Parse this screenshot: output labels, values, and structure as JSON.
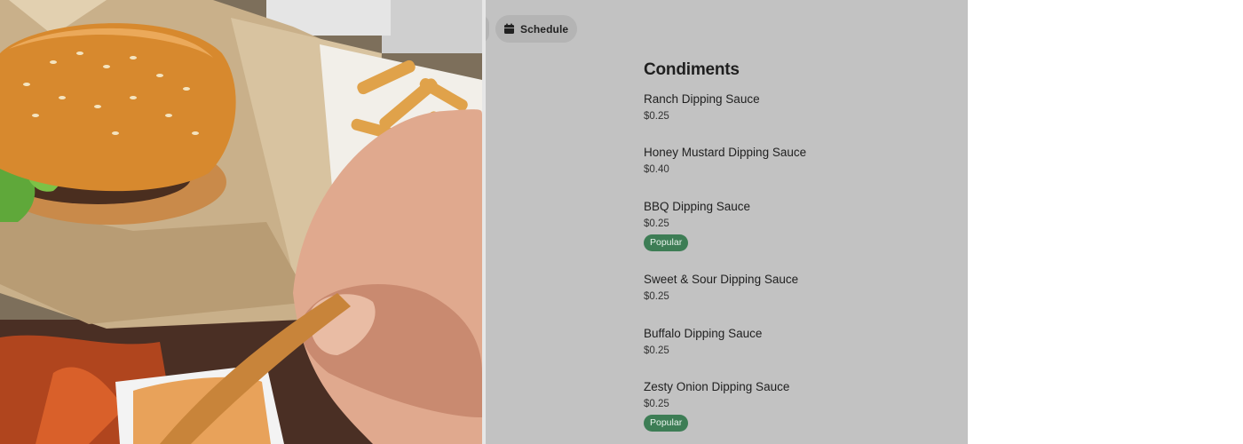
{
  "toolbar": {
    "schedule_label": "Schedule",
    "schedule_icon": "calendar-icon"
  },
  "section": {
    "title": "Condiments"
  },
  "items": [
    {
      "name": "Ranch Dipping Sauce",
      "price": "$0.25",
      "badge": ""
    },
    {
      "name": "Honey Mustard Dipping Sauce",
      "price": "$0.40",
      "badge": ""
    },
    {
      "name": "BBQ Dipping Sauce",
      "price": "$0.25",
      "badge": "Popular"
    },
    {
      "name": "Sweet & Sour Dipping Sauce",
      "price": "$0.25",
      "badge": ""
    },
    {
      "name": "Buffalo Dipping Sauce",
      "price": "$0.25",
      "badge": ""
    },
    {
      "name": "Zesty Onion Dipping Sauce",
      "price": "$0.25",
      "badge": "Popular"
    }
  ],
  "colors": {
    "panel_background": "#c2c2c2",
    "badge_background": "#3d7d55",
    "button_background": "#b4b4b4"
  }
}
